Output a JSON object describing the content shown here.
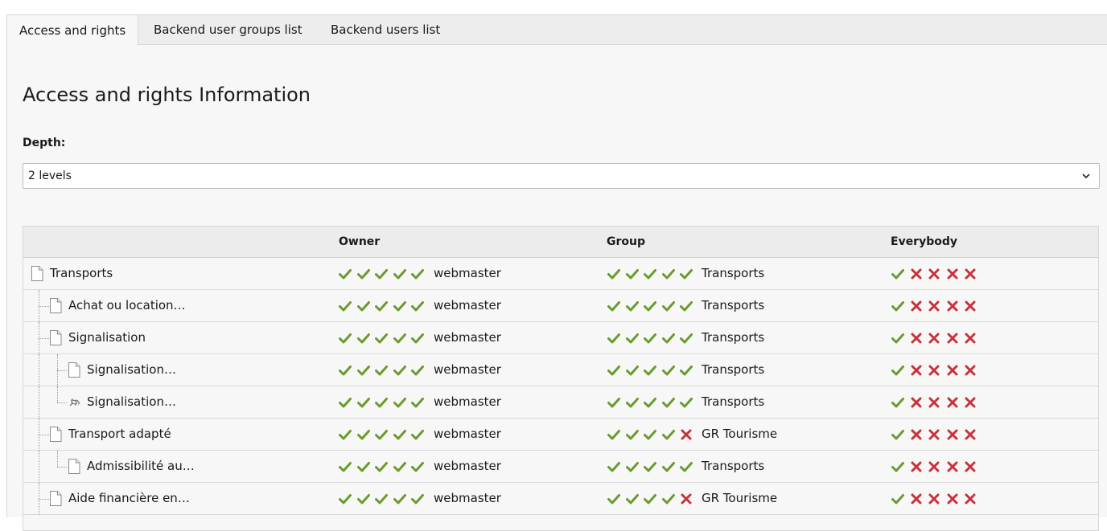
{
  "tabs": [
    {
      "label": "Access and rights"
    },
    {
      "label": "Backend user groups list"
    },
    {
      "label": "Backend users list"
    }
  ],
  "page_title": "Access and rights Information",
  "depth": {
    "label": "Depth:",
    "value": "2 levels"
  },
  "table": {
    "headers": {
      "owner": "Owner",
      "group": "Group",
      "everybody": "Everybody"
    },
    "rows": [
      {
        "title": "Transports",
        "level": 0,
        "icon": "page-icon",
        "owner_perms": [
          1,
          1,
          1,
          1,
          1
        ],
        "owner": "webmaster",
        "group_perms": [
          1,
          1,
          1,
          1,
          1
        ],
        "group": "Transports",
        "everybody_perms": [
          1,
          0,
          0,
          0,
          0
        ]
      },
      {
        "title": "Achat ou location…",
        "level": 1,
        "icon": "page-icon",
        "owner_perms": [
          1,
          1,
          1,
          1,
          1
        ],
        "owner": "webmaster",
        "group_perms": [
          1,
          1,
          1,
          1,
          1
        ],
        "group": "Transports",
        "everybody_perms": [
          1,
          0,
          0,
          0,
          0
        ]
      },
      {
        "title": "Signalisation",
        "level": 1,
        "icon": "page-icon",
        "owner_perms": [
          1,
          1,
          1,
          1,
          1
        ],
        "owner": "webmaster",
        "group_perms": [
          1,
          1,
          1,
          1,
          1
        ],
        "group": "Transports",
        "everybody_perms": [
          1,
          0,
          0,
          0,
          0
        ]
      },
      {
        "title": "Signalisation…",
        "level": 2,
        "icon": "page-icon",
        "owner_perms": [
          1,
          1,
          1,
          1,
          1
        ],
        "owner": "webmaster",
        "group_perms": [
          1,
          1,
          1,
          1,
          1
        ],
        "group": "Transports",
        "everybody_perms": [
          1,
          0,
          0,
          0,
          0
        ]
      },
      {
        "title": "Signalisation…",
        "level": 2,
        "icon": "link-icon",
        "owner_perms": [
          1,
          1,
          1,
          1,
          1
        ],
        "owner": "webmaster",
        "group_perms": [
          1,
          1,
          1,
          1,
          1
        ],
        "group": "Transports",
        "everybody_perms": [
          1,
          0,
          0,
          0,
          0
        ]
      },
      {
        "title": "Transport adapté",
        "level": 1,
        "icon": "page-icon",
        "owner_perms": [
          1,
          1,
          1,
          1,
          1
        ],
        "owner": "webmaster",
        "group_perms": [
          1,
          1,
          1,
          1,
          0
        ],
        "group": "GR Tourisme",
        "everybody_perms": [
          1,
          0,
          0,
          0,
          0
        ]
      },
      {
        "title": "Admissibilité au…",
        "level": 2,
        "icon": "page-icon",
        "owner_perms": [
          1,
          1,
          1,
          1,
          1
        ],
        "owner": "webmaster",
        "group_perms": [
          1,
          1,
          1,
          1,
          1
        ],
        "group": "Transports",
        "everybody_perms": [
          1,
          0,
          0,
          0,
          0
        ]
      },
      {
        "title": "Aide financière en…",
        "level": 1,
        "icon": "page-icon",
        "owner_perms": [
          1,
          1,
          1,
          1,
          1
        ],
        "owner": "webmaster",
        "group_perms": [
          1,
          1,
          1,
          1,
          0
        ],
        "group": "GR Tourisme",
        "everybody_perms": [
          1,
          0,
          0,
          0,
          0
        ]
      }
    ]
  },
  "colors": {
    "check": "#6a9b2e",
    "cross": "#c8323a"
  }
}
